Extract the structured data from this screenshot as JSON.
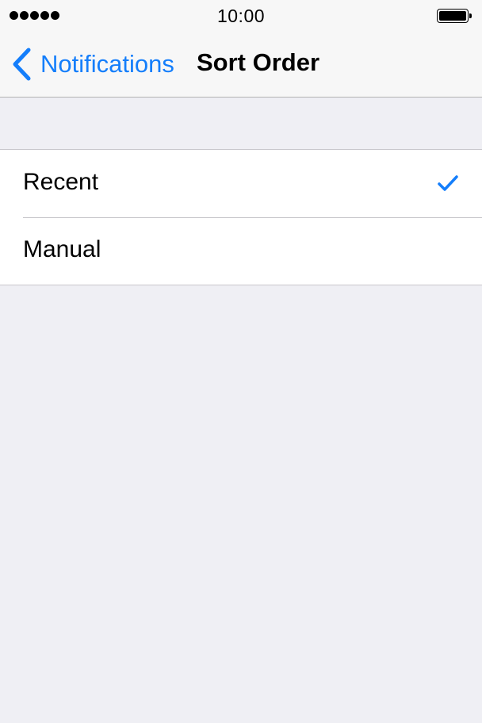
{
  "status_bar": {
    "time": "10:00",
    "signal_bars": 5,
    "battery_icon": "battery-full-icon"
  },
  "nav": {
    "back_label": "Notifications",
    "back_icon": "chevron-left-icon",
    "title": "Sort Order"
  },
  "options": {
    "items": [
      {
        "label": "Recent",
        "selected": true
      },
      {
        "label": "Manual",
        "selected": false
      }
    ],
    "check_icon": "checkmark-icon"
  },
  "colors": {
    "accent": "#147EFB",
    "background": "#EFEFF4",
    "bar_background": "#F7F7F7",
    "separator": "#C8C7CC"
  }
}
